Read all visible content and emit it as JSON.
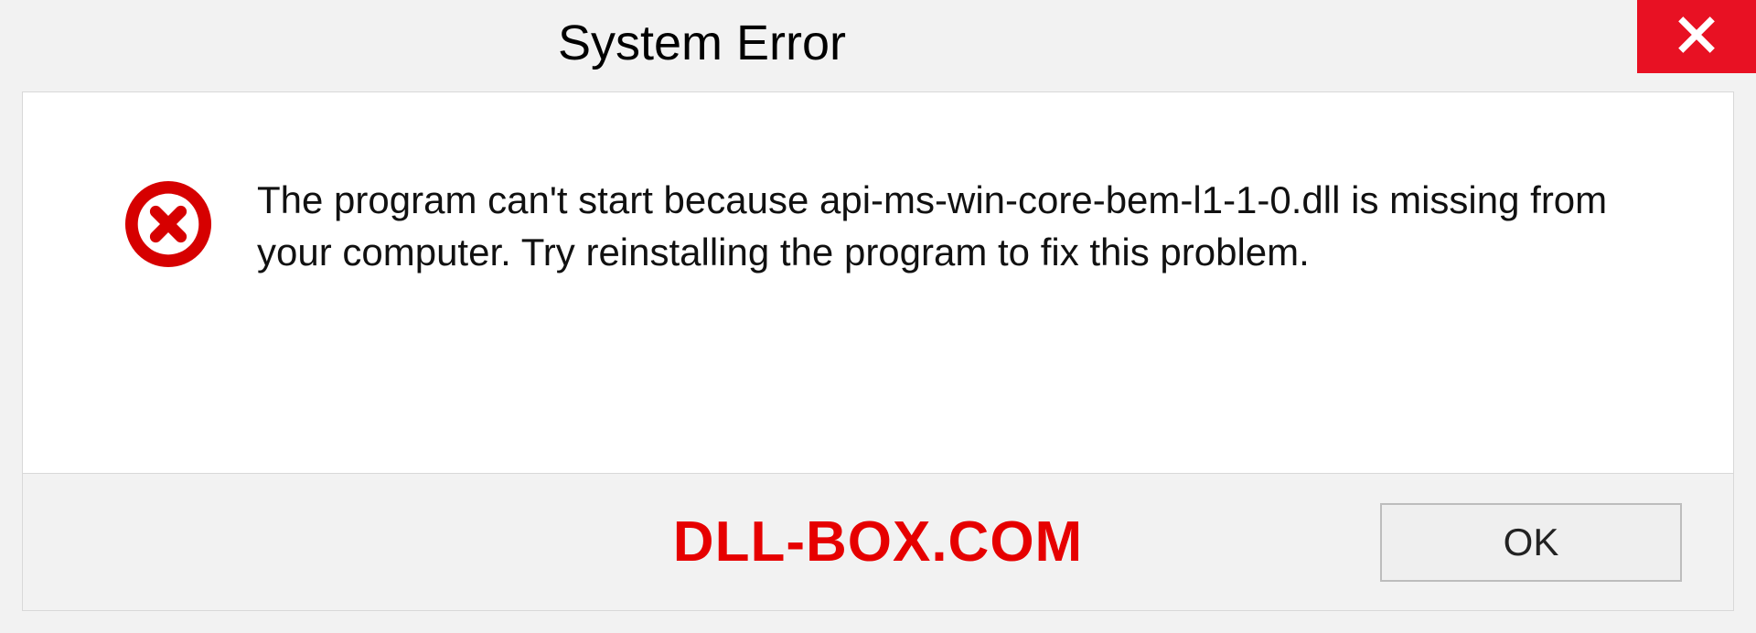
{
  "titlebar": {
    "title": "System Error"
  },
  "dialog": {
    "message": "The program can't start because api-ms-win-core-bem-l1-1-0.dll is missing from your computer. Try reinstalling the program to fix this problem."
  },
  "footer": {
    "watermark": "DLL-BOX.COM",
    "ok_label": "OK"
  },
  "colors": {
    "close_button": "#e81123",
    "error_icon": "#d60000",
    "watermark": "#e60000"
  }
}
